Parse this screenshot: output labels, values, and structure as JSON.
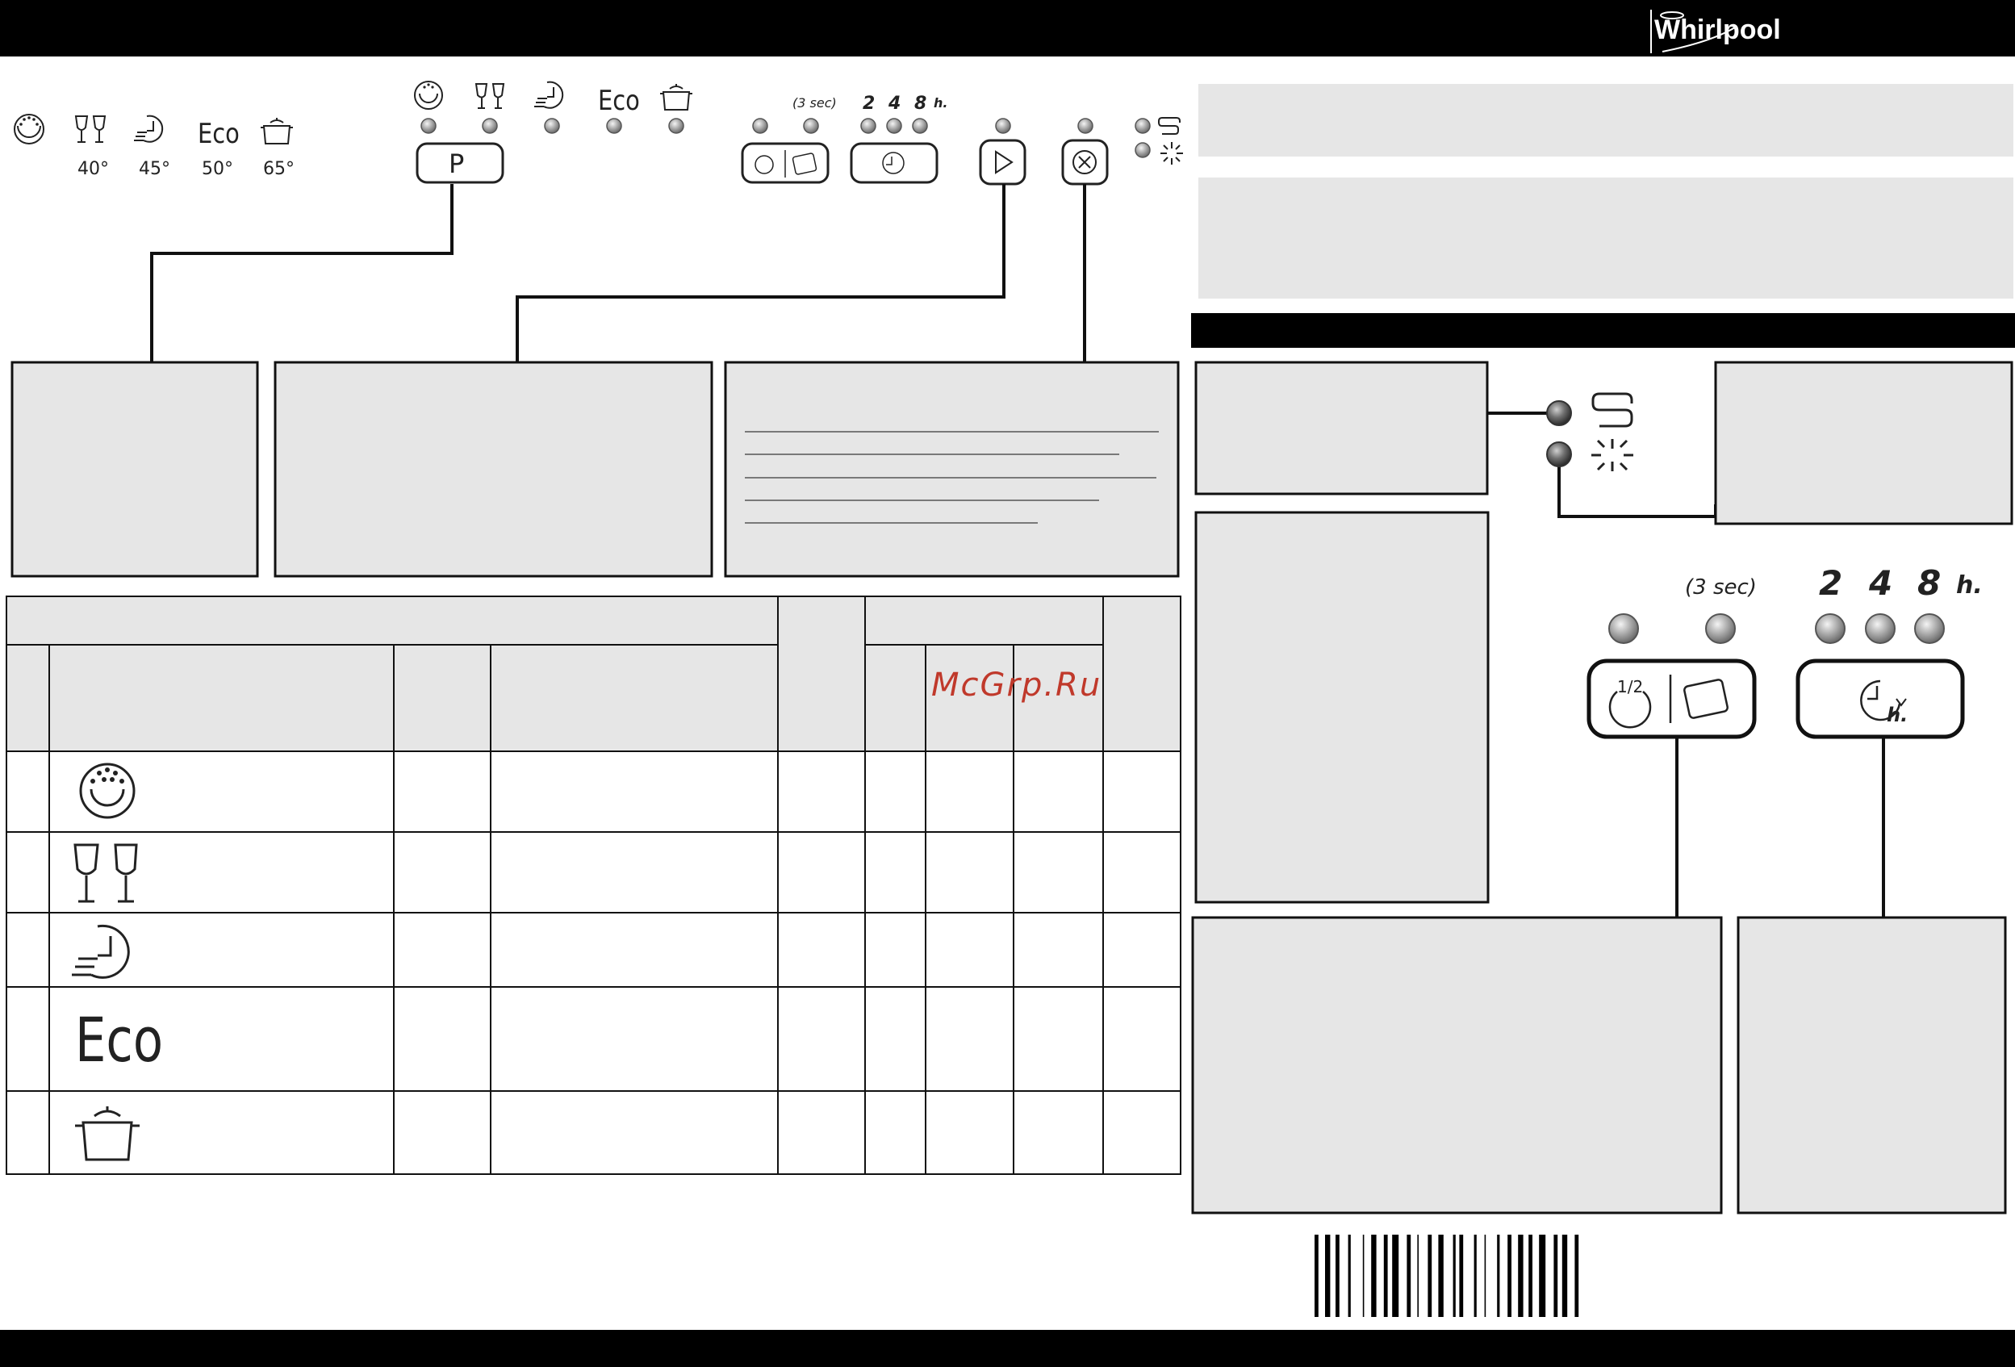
{
  "header": {
    "brand": "Whirlpool"
  },
  "panel": {
    "program_icons": [
      "prewash-icon",
      "glass-icon",
      "quick-wash-icon",
      "eco-icon",
      "intensive-pot-icon"
    ],
    "temperatures": [
      "40°",
      "45°",
      "50°",
      "65°"
    ],
    "eco_label": "Eco",
    "program_button": "P",
    "half_load_hint": "(3 sec)",
    "delay_hours": [
      "2",
      "4",
      "8"
    ],
    "delay_unit": "h.",
    "half_label": "1/2"
  },
  "watermark": "McGrp.Ru",
  "table": {
    "rows": [
      {
        "icon": "prewash-icon"
      },
      {
        "icon": "glass-icon"
      },
      {
        "icon": "quick-wash-icon"
      },
      {
        "icon": "eco-icon",
        "label": "Eco"
      },
      {
        "icon": "intensive-pot-icon"
      }
    ]
  },
  "colors": {
    "box": "#e6e6e6",
    "bar": "#000000",
    "led": "#9a9a9a",
    "watermark": "#c0392b"
  }
}
